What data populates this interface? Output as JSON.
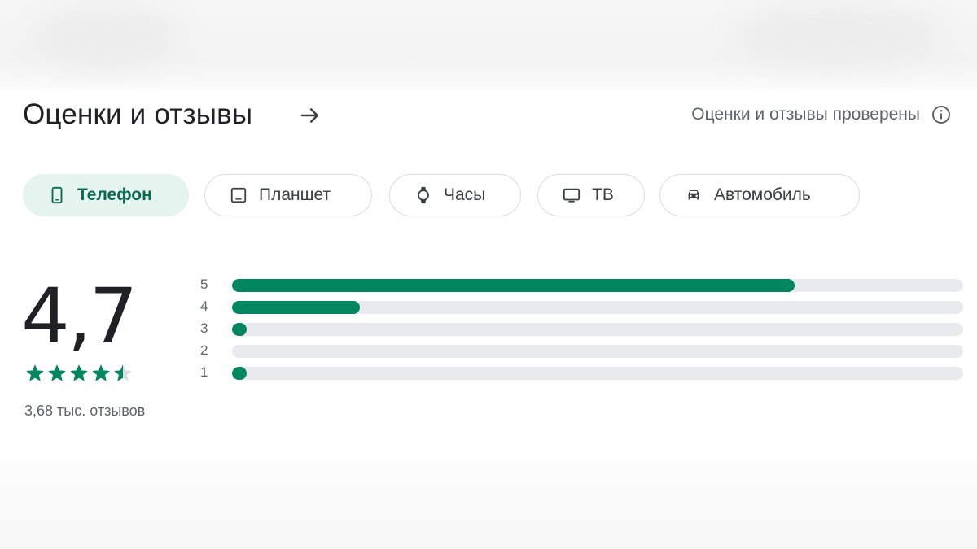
{
  "header": {
    "title": "Оценки и отзывы",
    "verified_text": "Оценки и отзывы проверены"
  },
  "device_tabs": [
    {
      "label": "Телефон",
      "icon": "phone-icon",
      "active": true
    },
    {
      "label": "Планшет",
      "icon": "tablet-icon",
      "active": false
    },
    {
      "label": "Часы",
      "icon": "watch-icon",
      "active": false
    },
    {
      "label": "ТВ",
      "icon": "tv-icon",
      "active": false
    },
    {
      "label": "Автомобиль",
      "icon": "car-icon",
      "active": false
    }
  ],
  "rating": {
    "score": "4,7",
    "stars_value": 4.7,
    "review_count": "3,68 тыс. отзывов"
  },
  "histogram": [
    {
      "label": "5",
      "fraction": 0.77
    },
    {
      "label": "4",
      "fraction": 0.175
    },
    {
      "label": "3",
      "fraction": 0.02
    },
    {
      "label": "2",
      "fraction": 0.0
    },
    {
      "label": "1",
      "fraction": 0.02
    }
  ],
  "colors": {
    "accent": "#01875f",
    "active_chip_bg": "#e6f4ef",
    "track": "#e8eaed"
  }
}
